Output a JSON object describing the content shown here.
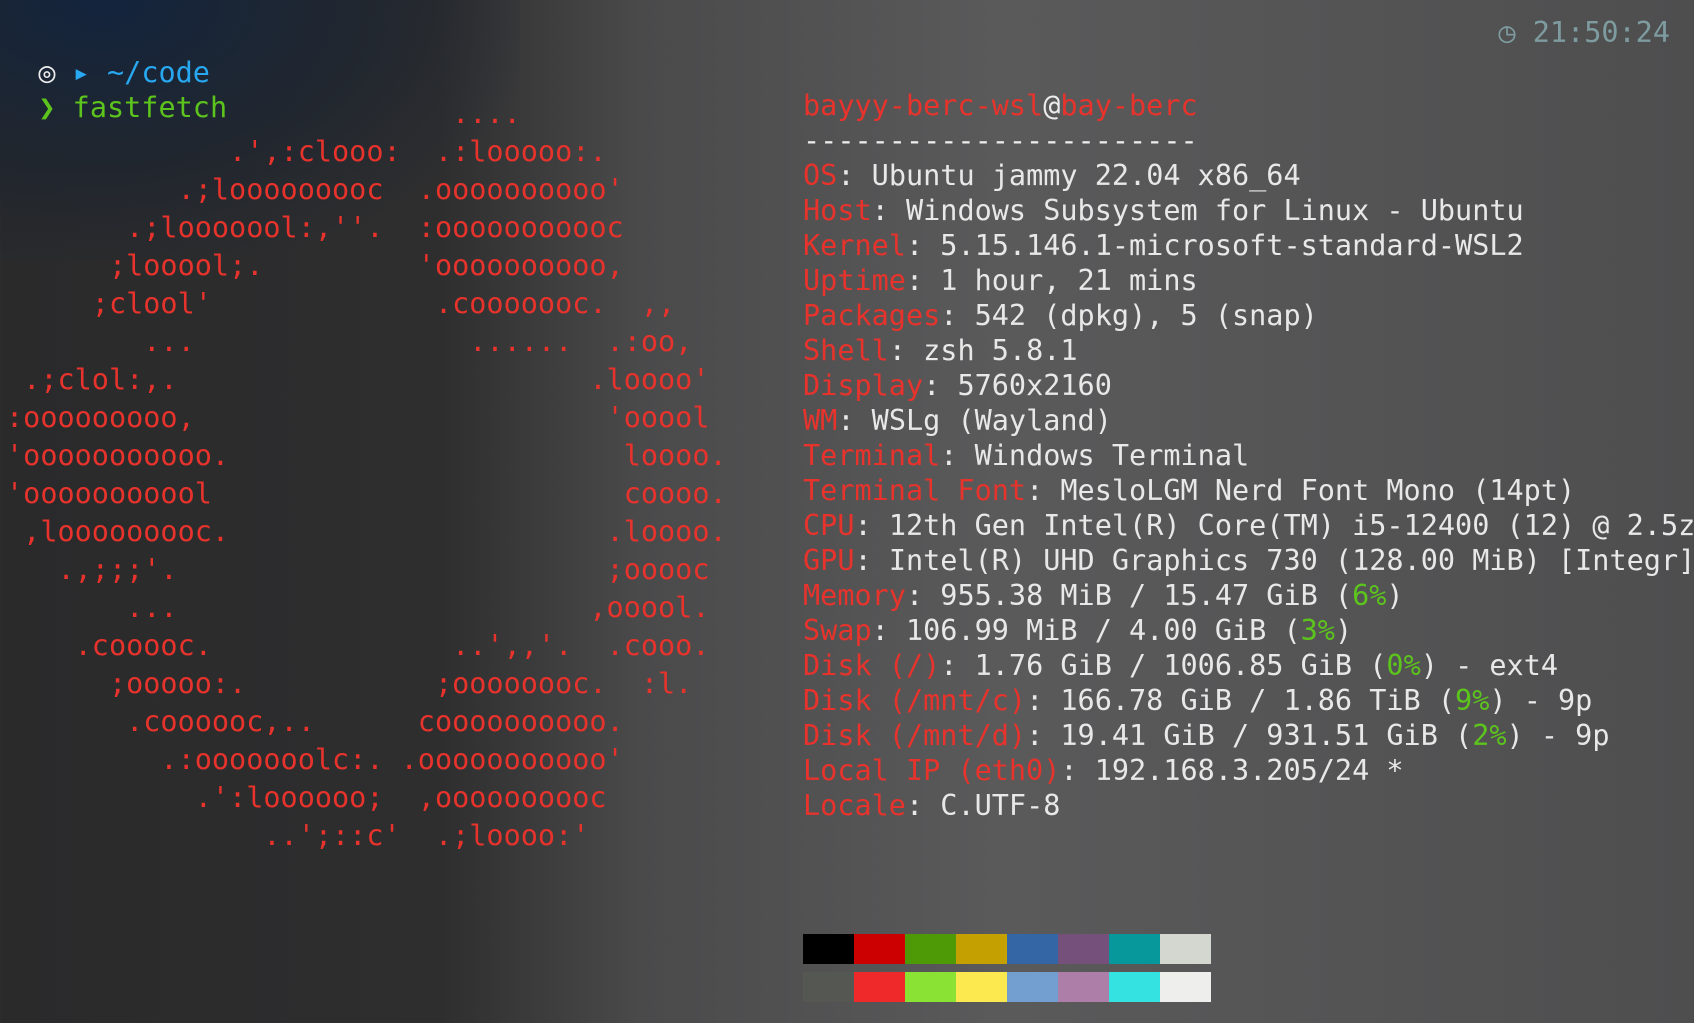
{
  "prompt": {
    "path_icon": "▸",
    "path": "~/code",
    "os_icon": "◎",
    "chevron": "❯",
    "command": "fastfetch",
    "clock_icon": "◷",
    "time": "21:50:24"
  },
  "logo": {
    "lines": [
      "                          ....",
      "             .',:clooo:  .:looooo:.",
      "          .;looooooooc  .oooooooooo'",
      "       .;looooool:,''.  :ooooooooooc",
      "      ;looool;.         'oooooooooo,",
      "     ;clool'             .cooooooc.  ,,",
      "        ...                ......  .:oo,",
      " .;clol:,.                        .loooo'",
      ":ooooooooo,                        'ooool",
      "'ooooooooooo.                       loooo.",
      "'ooooooooool                        coooo.",
      " ,looooooooc.                      .loooo.",
      "   .,;;;'.                         ;ooooc",
      "       ...                        ,ooool.",
      "    .cooooc.              ..',,'.  .cooo.",
      "      ;ooooo:.           ;oooooooc.  :l.",
      "       .coooooc,..      coooooooooo.",
      "         .:ooooooolc:. .ooooooooooo'",
      "           .':loooooo;  ,oooooooooc",
      "               ..';::c'  .;loooo:'"
    ]
  },
  "header": {
    "user": "bayyy-berc-wsl",
    "at": "@",
    "host": "bay-berc",
    "separator": "-----------------------"
  },
  "info": {
    "os": {
      "key": "OS",
      "value": "Ubuntu jammy 22.04 x86_64"
    },
    "host": {
      "key": "Host",
      "value": "Windows Subsystem for Linux - Ubuntu"
    },
    "kernel": {
      "key": "Kernel",
      "value": "5.15.146.1-microsoft-standard-WSL2"
    },
    "uptime": {
      "key": "Uptime",
      "value": "1 hour, 21 mins"
    },
    "packages": {
      "key": "Packages",
      "value": "542 (dpkg), 5 (snap)"
    },
    "shell": {
      "key": "Shell",
      "value": "zsh 5.8.1"
    },
    "display": {
      "key": "Display",
      "value": "5760x2160"
    },
    "wm": {
      "key": "WM",
      "value": "WSLg (Wayland)"
    },
    "terminal": {
      "key": "Terminal",
      "value": "Windows Terminal"
    },
    "terminal_font": {
      "key": "Terminal Font",
      "value": "MesloLGM Nerd Font Mono (14pt)"
    },
    "cpu": {
      "key": "CPU",
      "value": "12th Gen Intel(R) Core(TM) i5-12400 (12) @ 2.5z"
    },
    "gpu": {
      "key": "GPU",
      "value": "Intel(R) UHD Graphics 730 (128.00 MiB) [Integr]"
    },
    "memory": {
      "key": "Memory",
      "value_pre": "955.38 MiB / 15.47 GiB (",
      "pct": "6%",
      "value_post": ")"
    },
    "swap": {
      "key": "Swap",
      "value_pre": "106.99 MiB / 4.00 GiB (",
      "pct": "3%",
      "value_post": ")"
    },
    "disk_root": {
      "key": "Disk (/)",
      "value_pre": "1.76 GiB / 1006.85 GiB (",
      "pct": "0%",
      "value_post": ") - ext4"
    },
    "disk_c": {
      "key": "Disk (/mnt/c)",
      "value_pre": "166.78 GiB / 1.86 TiB (",
      "pct": "9%",
      "value_post": ") - 9p"
    },
    "disk_d": {
      "key": "Disk (/mnt/d)",
      "value_pre": "19.41 GiB / 931.51 GiB (",
      "pct": "2%",
      "value_post": ") - 9p"
    },
    "local_ip": {
      "key": "Local IP (eth0)",
      "value": "192.168.3.205/24 *"
    },
    "locale": {
      "key": "Locale",
      "value": "C.UTF-8"
    }
  },
  "palette": {
    "normal": [
      "#000000",
      "#cc0000",
      "#4e9a06",
      "#c4a000",
      "#3465a4",
      "#75507b",
      "#06989a",
      "#d3d7cf"
    ],
    "bright": [
      "#555753",
      "#ef2929",
      "#8ae234",
      "#fce94f",
      "#729fcf",
      "#ad7fa8",
      "#34e2e2",
      "#eeeeec"
    ]
  }
}
